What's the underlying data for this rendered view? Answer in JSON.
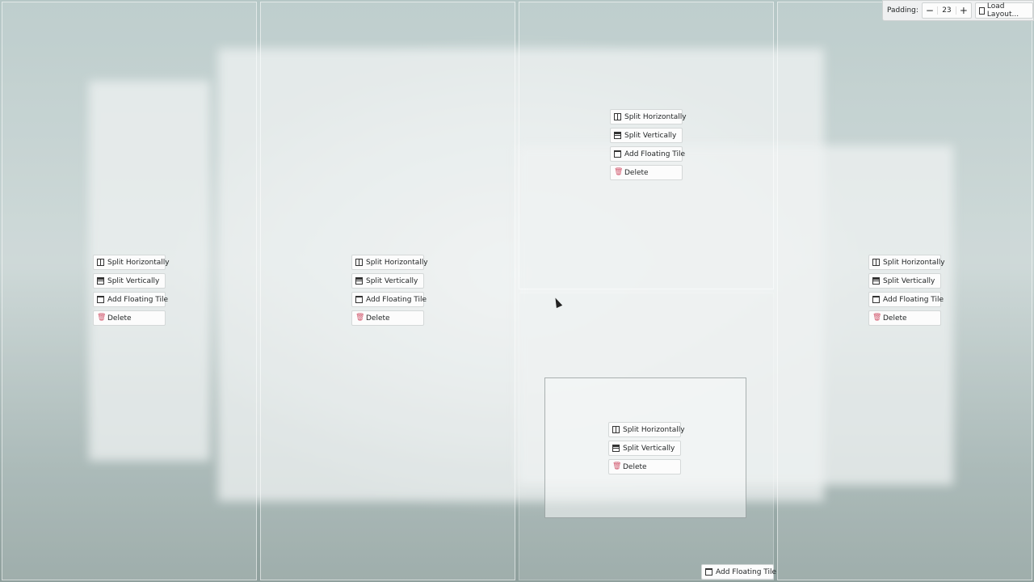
{
  "toolbar": {
    "padding_label": "Padding:",
    "padding_value": "23",
    "decrement": "−",
    "increment": "+",
    "load_layout": "Load Layout..."
  },
  "labels": {
    "split_h": "Split Horizontally",
    "split_v": "Split Vertically",
    "add_floating": "Add Floating Tile",
    "delete": "Delete"
  },
  "tiles": [
    {
      "name": "tile-column-1",
      "actions": [
        "split_h",
        "split_v",
        "add_floating",
        "delete"
      ]
    },
    {
      "name": "tile-column-2",
      "actions": [
        "split_h",
        "split_v",
        "add_floating",
        "delete"
      ]
    },
    {
      "name": "tile-column-3-top",
      "actions": [
        "split_h",
        "split_v",
        "add_floating",
        "delete"
      ]
    },
    {
      "name": "tile-column-4",
      "actions": [
        "split_h",
        "split_v",
        "add_floating",
        "delete"
      ]
    },
    {
      "name": "floating-tile",
      "actions": [
        "split_h",
        "split_v",
        "delete"
      ]
    }
  ],
  "bottom_add_floating": "Add Floating Tile",
  "colors": {
    "delete_icon": "#d0556b"
  }
}
